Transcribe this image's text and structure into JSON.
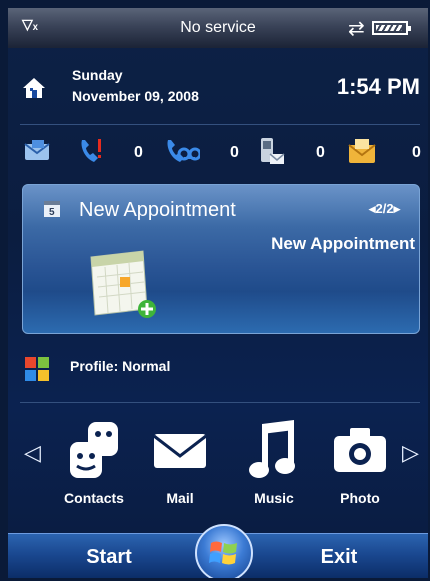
{
  "status": {
    "carrier": "No service",
    "signal_icon": "no-signal-icon",
    "sync_icon": "data-sync-icon",
    "battery_icon": "battery-icon"
  },
  "home": {
    "icon": "home-icon",
    "day": "Sunday",
    "date": "November 09, 2008",
    "time": "1:54 PM"
  },
  "notifications": [
    {
      "name": "messaging-icon",
      "count": ""
    },
    {
      "name": "missed-calls-icon",
      "count": "0"
    },
    {
      "name": "voicemail-icon",
      "count": "0"
    },
    {
      "name": "text-messages-icon",
      "count": "0"
    },
    {
      "name": "email-icon",
      "count": "0"
    }
  ],
  "appointment": {
    "icon": "calendar-small-icon",
    "title": "New Appointment",
    "pager": "◂2/2▸",
    "subtitle": "New Appointment",
    "illustration": "calendar-add-icon"
  },
  "profile": {
    "icon": "windows-flag-icon",
    "label": "Profile: Normal"
  },
  "apps": {
    "left_arrow": "◁",
    "right_arrow": "▷",
    "items": [
      {
        "label": "Contacts",
        "icon": "contacts-icon"
      },
      {
        "label": "Mail",
        "icon": "mail-icon"
      },
      {
        "label": "Music",
        "icon": "music-icon"
      },
      {
        "label": "Photo",
        "icon": "camera-icon"
      }
    ]
  },
  "softkeys": {
    "left": "Start",
    "right": "Exit",
    "center_icon": "windows-start-icon"
  },
  "colors": {
    "background": "#0b1d40",
    "card": "#2a5595",
    "softbar": "#1a4890"
  }
}
